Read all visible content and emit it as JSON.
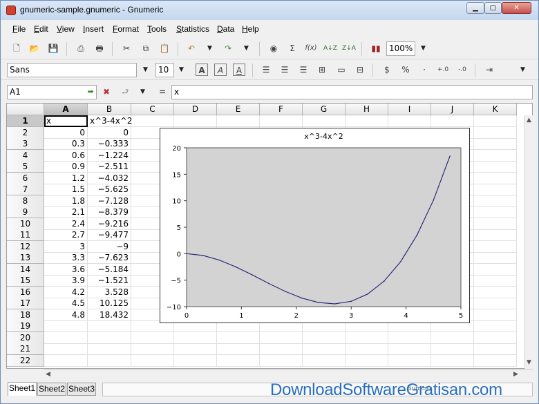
{
  "window": {
    "title": "gnumeric-sample.gnumeric - Gnumeric",
    "minimize_label": "▁",
    "maximize_label": "▢",
    "close_label": "✕"
  },
  "menu": [
    "File",
    "Edit",
    "View",
    "Insert",
    "Format",
    "Tools",
    "Statistics",
    "Data",
    "Help"
  ],
  "toolbar": {
    "zoom": "100%"
  },
  "format_toolbar": {
    "font_name": "Sans",
    "font_size": "10",
    "percent_label": "%"
  },
  "formula_bar": {
    "cell_ref": "A1",
    "equals": "=",
    "content": "x"
  },
  "columns": [
    "A",
    "B",
    "C",
    "D",
    "E",
    "F",
    "G",
    "H",
    "I",
    "J",
    "K"
  ],
  "rows": [
    "1",
    "2",
    "3",
    "4",
    "5",
    "6",
    "7",
    "8",
    "9",
    "10",
    "11",
    "12",
    "13",
    "14",
    "15",
    "16",
    "17",
    "18",
    "19",
    "20",
    "21",
    "22"
  ],
  "cells": {
    "header_a": "x",
    "header_b": "x^3-4x^2",
    "col_a": [
      "0",
      "0.3",
      "0.6",
      "0.9",
      "1.2",
      "1.5",
      "1.8",
      "2.1",
      "2.4",
      "2.7",
      "3",
      "3.3",
      "3.6",
      "3.9",
      "4.2",
      "4.5",
      "4.8"
    ],
    "col_b": [
      "0",
      "−0.333",
      "−1.224",
      "−2.511",
      "−4.032",
      "−5.625",
      "−7.128",
      "−8.379",
      "−9.216",
      "−9.477",
      "−9",
      "−7.623",
      "−5.184",
      "−1.521",
      "3.528",
      "10.125",
      "18.432"
    ]
  },
  "sheets": [
    "Sheet1",
    "Sheet2",
    "Sheet3"
  ],
  "status": {
    "sum_label": "Sum=0"
  },
  "watermark": "DownloadSoftwareGratisan.com",
  "colors": {
    "series_line": "#2b2b7a",
    "plot_bg": "#d3d3d3"
  },
  "chart_data": {
    "type": "line",
    "title": "x^3-4x^2",
    "x": [
      0,
      0.3,
      0.6,
      0.9,
      1.2,
      1.5,
      1.8,
      2.1,
      2.4,
      2.7,
      3,
      3.3,
      3.6,
      3.9,
      4.2,
      4.5,
      4.8
    ],
    "series": [
      {
        "values": [
          0,
          -0.333,
          -1.224,
          -2.511,
          -4.032,
          -5.625,
          -7.128,
          -8.379,
          -9.216,
          -9.477,
          -9,
          -7.623,
          -5.184,
          -1.521,
          3.528,
          10.125,
          18.432
        ]
      }
    ],
    "xlim": [
      0,
      5
    ],
    "ylim": [
      -10,
      20
    ],
    "x_ticks": [
      "0",
      "1",
      "2",
      "3",
      "4",
      "5"
    ],
    "y_ticks": [
      "−10",
      "−5",
      "0",
      "5",
      "10",
      "15",
      "20"
    ],
    "grid": false,
    "legend": "none"
  }
}
